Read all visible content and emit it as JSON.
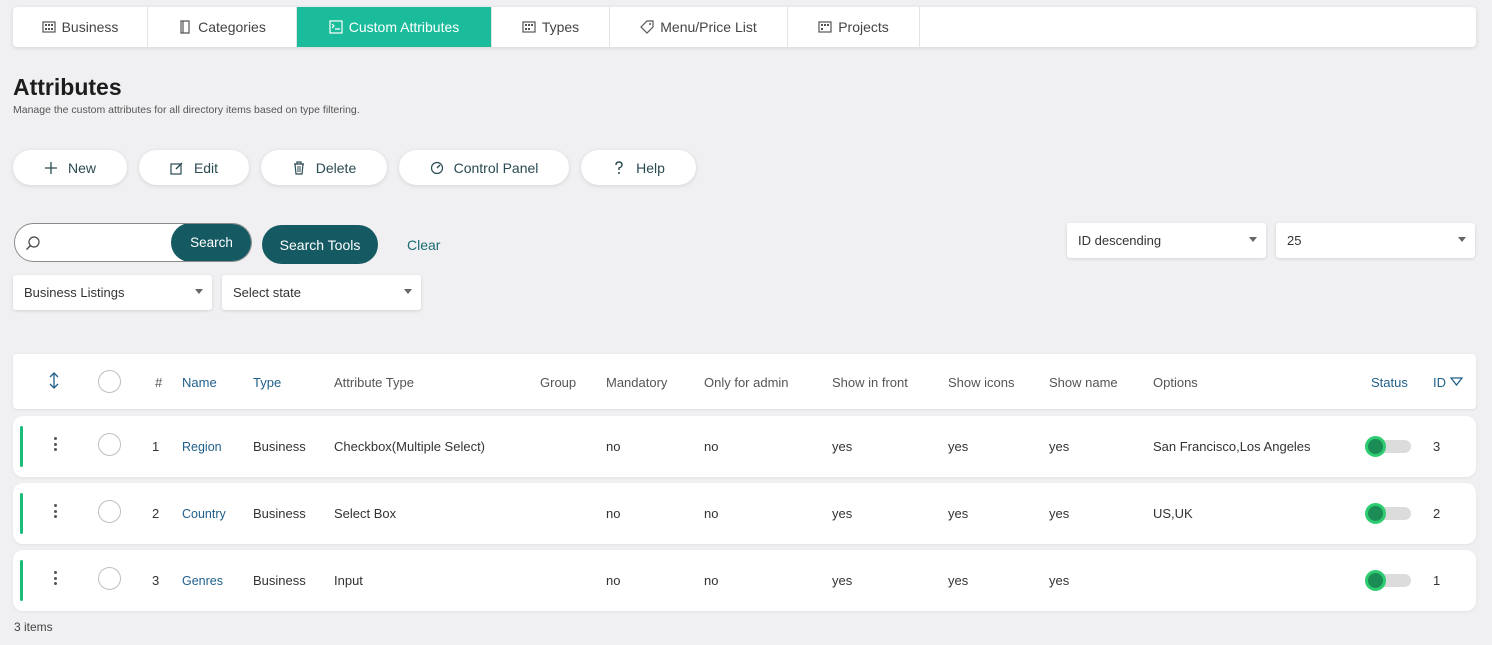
{
  "tabs": [
    {
      "label": "Business",
      "icon": "building-icon",
      "active": false
    },
    {
      "label": "Categories",
      "icon": "book-icon",
      "active": false
    },
    {
      "label": "Custom Attributes",
      "icon": "attributes-icon",
      "active": true
    },
    {
      "label": "Types",
      "icon": "types-icon",
      "active": false
    },
    {
      "label": "Menu/Price List",
      "icon": "tag-icon",
      "active": false
    },
    {
      "label": "Projects",
      "icon": "projects-icon",
      "active": false
    }
  ],
  "page": {
    "title": "Attributes",
    "subtitle": "Manage the custom attributes for all directory items based on type filtering."
  },
  "actions": {
    "new": "New",
    "edit": "Edit",
    "delete": "Delete",
    "control_panel": "Control Panel",
    "help": "Help"
  },
  "search": {
    "value": "",
    "placeholder": "",
    "button": "Search",
    "tools": "Search Tools",
    "clear": "Clear"
  },
  "filters": {
    "ordering": "ID descending",
    "limit": "25",
    "listing_type": "Business Listings",
    "state": "Select state"
  },
  "table": {
    "headers": {
      "number": "#",
      "name": "Name",
      "type": "Type",
      "attribute_type": "Attribute Type",
      "group": "Group",
      "mandatory": "Mandatory",
      "only_admin": "Only for admin",
      "show_front": "Show in front",
      "show_icons": "Show icons",
      "show_name": "Show name",
      "options": "Options",
      "status": "Status",
      "id": "ID"
    },
    "rows": [
      {
        "num": "1",
        "name": "Region",
        "type": "Business",
        "attribute_type": "Checkbox(Multiple Select)",
        "group": "",
        "mandatory": "no",
        "only_admin": "no",
        "show_front": "yes",
        "show_icons": "yes",
        "show_name": "yes",
        "options": "San Francisco,Los Angeles",
        "id": "3"
      },
      {
        "num": "2",
        "name": "Country",
        "type": "Business",
        "attribute_type": "Select Box",
        "group": "",
        "mandatory": "no",
        "only_admin": "no",
        "show_front": "yes",
        "show_icons": "yes",
        "show_name": "yes",
        "options": "US,UK",
        "id": "2"
      },
      {
        "num": "3",
        "name": "Genres",
        "type": "Business",
        "attribute_type": "Input",
        "group": "",
        "mandatory": "no",
        "only_admin": "no",
        "show_front": "yes",
        "show_icons": "yes",
        "show_name": "yes",
        "options": "",
        "id": "1"
      }
    ]
  },
  "footer": {
    "items_count": "3 items"
  },
  "colors": {
    "accent": "#1bbc9b",
    "primary_dark": "#155a63",
    "link": "#1f5f8b",
    "status_on": "#2ecc71"
  }
}
